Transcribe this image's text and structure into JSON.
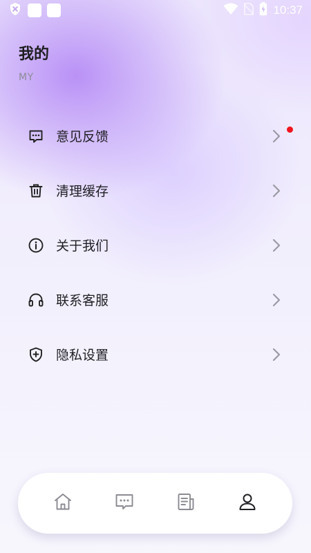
{
  "status_bar": {
    "time": "10:37",
    "icons": [
      "shield-x-icon",
      "app-icon",
      "app-icon",
      "wifi-icon",
      "no-sim-icon",
      "battery-charging-icon"
    ]
  },
  "header": {
    "title": "我的",
    "subtitle": "MY"
  },
  "menu": {
    "items": [
      {
        "label": "意见反馈",
        "icon": "feedback-icon",
        "has_badge": true
      },
      {
        "label": "清理缓存",
        "icon": "trash-icon",
        "has_badge": false
      },
      {
        "label": "关于我们",
        "icon": "info-icon",
        "has_badge": false
      },
      {
        "label": "联系客服",
        "icon": "headset-icon",
        "has_badge": false
      },
      {
        "label": "隐私设置",
        "icon": "shield-plus-icon",
        "has_badge": false
      }
    ]
  },
  "tab_bar": {
    "tabs": [
      "home-icon",
      "message-icon",
      "news-icon",
      "profile-icon"
    ],
    "active_tab": "profile-icon"
  },
  "colors": {
    "accent_badge": "#f0141e",
    "text_primary": "#1f1f24",
    "text_secondary": "#8c8c96"
  }
}
